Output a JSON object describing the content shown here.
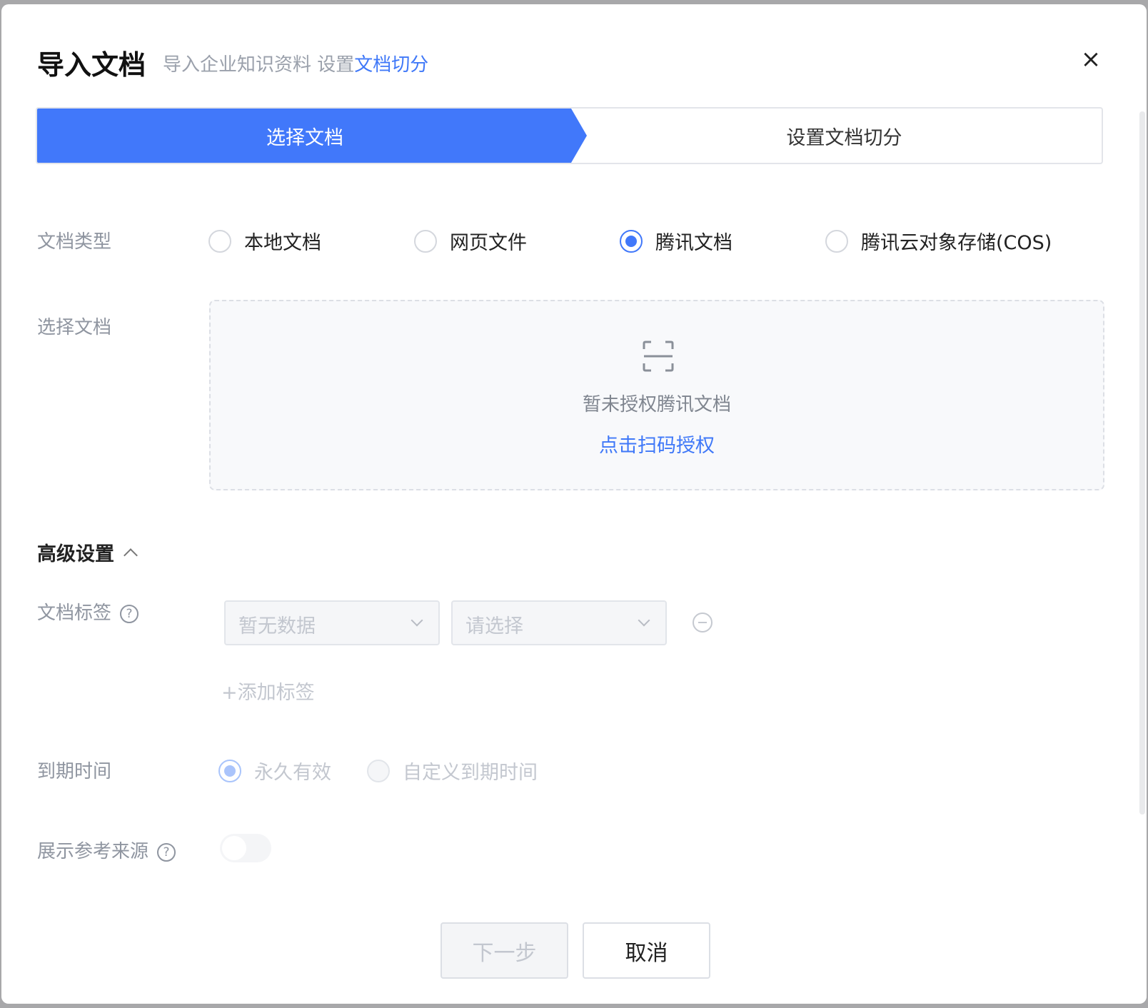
{
  "dialog": {
    "title": "导入文档",
    "subtitle_prefix": "导入企业知识资料 设置",
    "subtitle_link": "文档切分",
    "close_icon": "×"
  },
  "steps": [
    {
      "label": "选择文档",
      "active": true
    },
    {
      "label": "设置文档切分",
      "active": false
    }
  ],
  "doc_type": {
    "label": "文档类型",
    "options": [
      "本地文档",
      "网页文件",
      "腾讯文档",
      "腾讯云对象存储(COS)"
    ],
    "selected": "腾讯文档"
  },
  "select_doc": {
    "label": "选择文档",
    "empty_text": "暂未授权腾讯文档",
    "auth_link": "点击扫码授权"
  },
  "advanced": {
    "title": "高级设置",
    "tags": {
      "label": "文档标签",
      "help": "?",
      "key_placeholder": "暂无数据",
      "value_placeholder": "请选择",
      "add_label": "+添加标签"
    },
    "expiry": {
      "label": "到期时间",
      "options": [
        "永久有效",
        "自定义到期时间"
      ],
      "selected": "永久有效"
    },
    "show_source": {
      "label": "展示参考来源",
      "help": "?",
      "enabled": false
    }
  },
  "footer": {
    "next": "下一步",
    "cancel": "取消"
  },
  "colors": {
    "accent": "#4178fa"
  }
}
